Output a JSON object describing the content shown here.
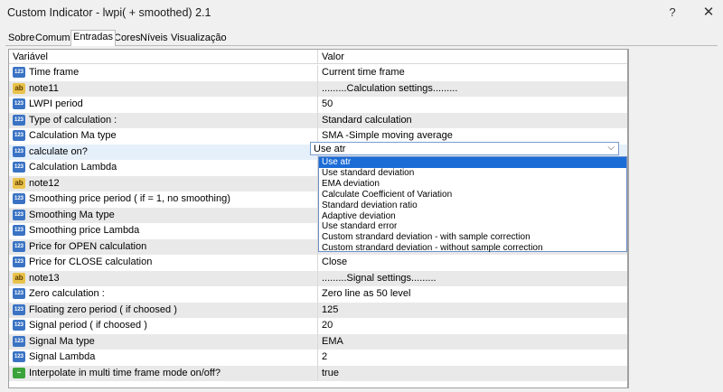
{
  "window": {
    "title": "Custom Indicator - lwpi( + smoothed) 2.1",
    "help": "?",
    "close": "✕"
  },
  "tabs": [
    "Sobre",
    "Comum",
    "Entradas",
    "Cores",
    "Níveis",
    "Visualização"
  ],
  "active_tab": "Entradas",
  "table": {
    "headers": {
      "variable": "Variável",
      "value": "Valor"
    },
    "rows": [
      {
        "type": "num",
        "name": "Time frame",
        "value": "Current time frame"
      },
      {
        "type": "str",
        "name": "note11",
        "value": ".........Calculation settings........."
      },
      {
        "type": "num",
        "name": "LWPI period",
        "value": "50"
      },
      {
        "type": "num",
        "name": "Type of calculation :",
        "value": "Standard calculation"
      },
      {
        "type": "num",
        "name": "Calculation Ma type",
        "value": "SMA -Simple moving average"
      },
      {
        "type": "num",
        "name": "calculate on?",
        "value": "Use atr"
      },
      {
        "type": "num",
        "name": "Calculation Lambda",
        "value": ""
      },
      {
        "type": "str",
        "name": "note12",
        "value": ""
      },
      {
        "type": "num",
        "name": "Smoothing price period ( if = 1, no smoothing)",
        "value": ""
      },
      {
        "type": "num",
        "name": "Smoothing Ma type",
        "value": ""
      },
      {
        "type": "num",
        "name": "Smoothing price Lambda",
        "value": ""
      },
      {
        "type": "num",
        "name": "Price for OPEN calculation",
        "value": ""
      },
      {
        "type": "num",
        "name": "Price for CLOSE calculation",
        "value": "Close"
      },
      {
        "type": "str",
        "name": "note13",
        "value": ".........Signal settings........."
      },
      {
        "type": "num",
        "name": "Zero calculation :",
        "value": "Zero line as 50 level"
      },
      {
        "type": "num",
        "name": "Floating zero period ( if choosed )",
        "value": "125"
      },
      {
        "type": "num",
        "name": "Signal period ( if choosed )",
        "value": "20"
      },
      {
        "type": "num",
        "name": "Signal Ma type",
        "value": "EMA"
      },
      {
        "type": "num",
        "name": "Signal Lambda",
        "value": "2"
      },
      {
        "type": "bool",
        "name": "Interpolate in multi time frame mode on/off?",
        "value": "true"
      }
    ]
  },
  "dropdown": {
    "selected": "Use atr",
    "options": [
      "Use atr",
      "Use standard deviation",
      "EMA deviation",
      "Calculate Coefficient of Variation",
      "Standard deviation ratio",
      "Adaptive deviation",
      "Use standard error",
      "Custom strandard deviation - with sample correction",
      "Custom strandard deviation - without sample correction"
    ]
  },
  "icons": {
    "num": "123",
    "str": "ab",
    "bool": "~"
  }
}
